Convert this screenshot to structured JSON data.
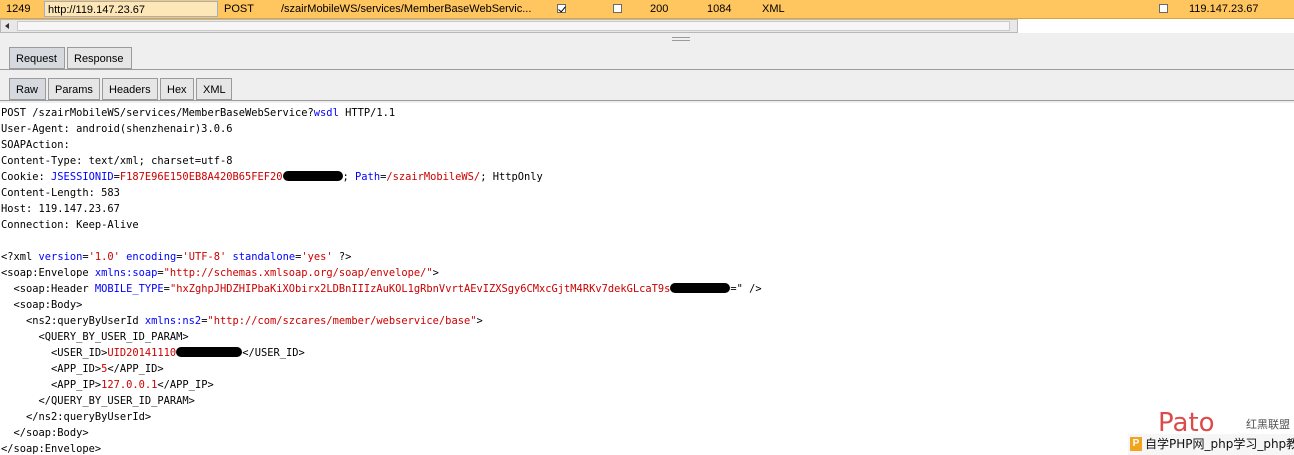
{
  "history": {
    "number": "1249",
    "host": "http://119.147.23.67",
    "method": "POST",
    "url": "/szairMobileWS/services/MemberBaseWebServic...",
    "params_checked": true,
    "edited_checked": false,
    "status": "200",
    "length": "1084",
    "mime": "XML",
    "ssl_checked": false,
    "ip": "119.147.23.67"
  },
  "main_tabs": [
    {
      "label": "Request",
      "active": true
    },
    {
      "label": "Response",
      "active": false
    }
  ],
  "sub_tabs": [
    {
      "label": "Raw",
      "active": true
    },
    {
      "label": "Params",
      "active": false
    },
    {
      "label": "Headers",
      "active": false
    },
    {
      "label": "Hex",
      "active": false
    },
    {
      "label": "XML",
      "active": false
    }
  ],
  "request": {
    "l1_a": "POST /szairMobileWS/services/MemberBaseWebService?",
    "l1_b": "wsdl",
    "l1_c": " HTTP/1.1",
    "l2": "User-Agent: android(shenzhenair)3.0.6",
    "l3": "SOAPAction:",
    "l4": "Content-Type: text/xml; charset=utf-8",
    "l5_a": "Cookie: ",
    "l5_b": "JSESSIONID",
    "l5_c": "=",
    "l5_d": "F187E96E150EB8A420B65FEF20",
    "l5_e": "; ",
    "l5_f": "Path",
    "l5_g": "=",
    "l5_h": "/szairMobileWS/",
    "l5_i": "; HttpOnly",
    "l6": "Content-Length: 583",
    "l7": "Host: 119.147.23.67",
    "l8": "Connection: Keep-Alive",
    "x1_a": "<?xml ",
    "x1_b": "version",
    "x1_c": "=",
    "x1_d": "'1.0'",
    "x1_e": "encoding",
    "x1_f": "'UTF-8'",
    "x1_g": "standalone",
    "x1_h": "'yes'",
    "x1_i": " ?>",
    "x2_a": "<soap:Envelope ",
    "x2_b": "xmlns:soap",
    "x2_c": "\"http://schemas.xmlsoap.org/soap/envelope/\"",
    "x2_d": ">",
    "x3_a": "  <soap:Header ",
    "x3_b": "MOBILE_TYPE",
    "x3_c": "\"hxZghpJHDZHIPbaKiXObirx2LDBnIIIzAuKOL1gRbnVvrtAEvIZXSgy6CMxcGjtM4RKv7dekGLcaT9s",
    "x3_d": "=\" />",
    "x4": "  <soap:Body>",
    "x5_a": "    <ns2:queryByUserId ",
    "x5_b": "xmlns:ns2",
    "x5_c": "\"http://com/szcares/member/webservice/base\"",
    "x5_d": ">",
    "x6": "      <QUERY_BY_USER_ID_PARAM>",
    "x7_a": "        <USER_ID>",
    "x7_b": "UID20141110",
    "x7_c": "</USER_ID>",
    "x8_a": "        <APP_ID>",
    "x8_b": "5",
    "x8_c": "</APP_ID>",
    "x9_a": "        <APP_IP>",
    "x9_b": "127.0.0.1",
    "x9_c": "</APP_IP>",
    "x10": "      </QUERY_BY_USER_ID_PARAM>",
    "x11": "    </ns2:queryByUserId>",
    "x12": "  </soap:Body>",
    "x13": "</soap:Envelope>"
  },
  "watermark": {
    "badge": "P",
    "text": "自学PHP网_php学习_php教",
    "brand": "Pato",
    "brand_cn": "红黑联盟"
  },
  "colors": {
    "selected_row": "#ffc55e",
    "keyword": "#0000ff",
    "value": "#cc0000"
  }
}
